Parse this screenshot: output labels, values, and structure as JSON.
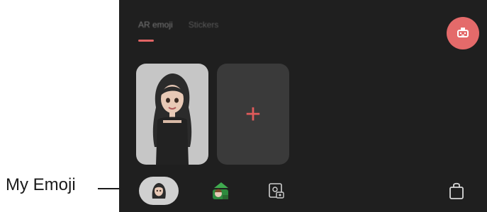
{
  "callout": {
    "label": "My Emoji"
  },
  "tabs": [
    {
      "label": "AR emoji",
      "active": true
    },
    {
      "label": "Stickers",
      "active": false
    }
  ],
  "add_card": {
    "symbol": "+"
  },
  "colors": {
    "accent": "#e46a6a",
    "background": "#1f1f1f",
    "card_add": "#3a3a3a"
  },
  "icons": {
    "fab": "avatar-create-icon",
    "my_emoji": "my-emoji-avatar-icon",
    "sticker": "sticker-icon",
    "frame": "emoji-frame-icon",
    "shop": "shopping-bag-icon"
  }
}
